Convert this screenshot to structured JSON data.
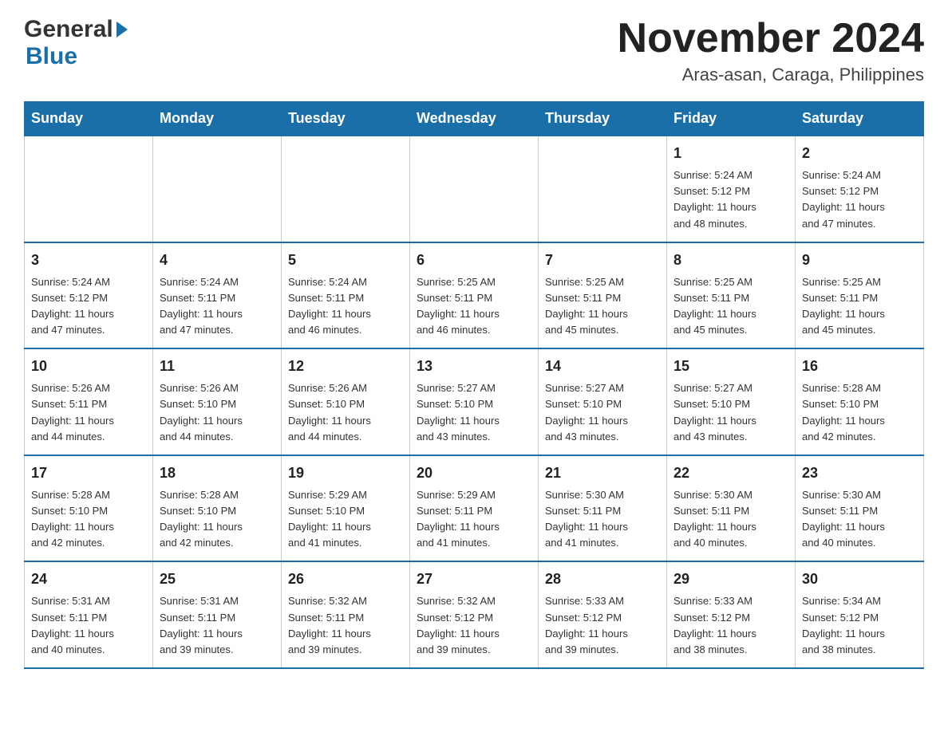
{
  "logo": {
    "general": "General",
    "blue": "Blue"
  },
  "title": {
    "month_year": "November 2024",
    "location": "Aras-asan, Caraga, Philippines"
  },
  "weekdays": [
    "Sunday",
    "Monday",
    "Tuesday",
    "Wednesday",
    "Thursday",
    "Friday",
    "Saturday"
  ],
  "weeks": [
    [
      {
        "day": "",
        "info": ""
      },
      {
        "day": "",
        "info": ""
      },
      {
        "day": "",
        "info": ""
      },
      {
        "day": "",
        "info": ""
      },
      {
        "day": "",
        "info": ""
      },
      {
        "day": "1",
        "info": "Sunrise: 5:24 AM\nSunset: 5:12 PM\nDaylight: 11 hours\nand 48 minutes."
      },
      {
        "day": "2",
        "info": "Sunrise: 5:24 AM\nSunset: 5:12 PM\nDaylight: 11 hours\nand 47 minutes."
      }
    ],
    [
      {
        "day": "3",
        "info": "Sunrise: 5:24 AM\nSunset: 5:12 PM\nDaylight: 11 hours\nand 47 minutes."
      },
      {
        "day": "4",
        "info": "Sunrise: 5:24 AM\nSunset: 5:11 PM\nDaylight: 11 hours\nand 47 minutes."
      },
      {
        "day": "5",
        "info": "Sunrise: 5:24 AM\nSunset: 5:11 PM\nDaylight: 11 hours\nand 46 minutes."
      },
      {
        "day": "6",
        "info": "Sunrise: 5:25 AM\nSunset: 5:11 PM\nDaylight: 11 hours\nand 46 minutes."
      },
      {
        "day": "7",
        "info": "Sunrise: 5:25 AM\nSunset: 5:11 PM\nDaylight: 11 hours\nand 45 minutes."
      },
      {
        "day": "8",
        "info": "Sunrise: 5:25 AM\nSunset: 5:11 PM\nDaylight: 11 hours\nand 45 minutes."
      },
      {
        "day": "9",
        "info": "Sunrise: 5:25 AM\nSunset: 5:11 PM\nDaylight: 11 hours\nand 45 minutes."
      }
    ],
    [
      {
        "day": "10",
        "info": "Sunrise: 5:26 AM\nSunset: 5:11 PM\nDaylight: 11 hours\nand 44 minutes."
      },
      {
        "day": "11",
        "info": "Sunrise: 5:26 AM\nSunset: 5:10 PM\nDaylight: 11 hours\nand 44 minutes."
      },
      {
        "day": "12",
        "info": "Sunrise: 5:26 AM\nSunset: 5:10 PM\nDaylight: 11 hours\nand 44 minutes."
      },
      {
        "day": "13",
        "info": "Sunrise: 5:27 AM\nSunset: 5:10 PM\nDaylight: 11 hours\nand 43 minutes."
      },
      {
        "day": "14",
        "info": "Sunrise: 5:27 AM\nSunset: 5:10 PM\nDaylight: 11 hours\nand 43 minutes."
      },
      {
        "day": "15",
        "info": "Sunrise: 5:27 AM\nSunset: 5:10 PM\nDaylight: 11 hours\nand 43 minutes."
      },
      {
        "day": "16",
        "info": "Sunrise: 5:28 AM\nSunset: 5:10 PM\nDaylight: 11 hours\nand 42 minutes."
      }
    ],
    [
      {
        "day": "17",
        "info": "Sunrise: 5:28 AM\nSunset: 5:10 PM\nDaylight: 11 hours\nand 42 minutes."
      },
      {
        "day": "18",
        "info": "Sunrise: 5:28 AM\nSunset: 5:10 PM\nDaylight: 11 hours\nand 42 minutes."
      },
      {
        "day": "19",
        "info": "Sunrise: 5:29 AM\nSunset: 5:10 PM\nDaylight: 11 hours\nand 41 minutes."
      },
      {
        "day": "20",
        "info": "Sunrise: 5:29 AM\nSunset: 5:11 PM\nDaylight: 11 hours\nand 41 minutes."
      },
      {
        "day": "21",
        "info": "Sunrise: 5:30 AM\nSunset: 5:11 PM\nDaylight: 11 hours\nand 41 minutes."
      },
      {
        "day": "22",
        "info": "Sunrise: 5:30 AM\nSunset: 5:11 PM\nDaylight: 11 hours\nand 40 minutes."
      },
      {
        "day": "23",
        "info": "Sunrise: 5:30 AM\nSunset: 5:11 PM\nDaylight: 11 hours\nand 40 minutes."
      }
    ],
    [
      {
        "day": "24",
        "info": "Sunrise: 5:31 AM\nSunset: 5:11 PM\nDaylight: 11 hours\nand 40 minutes."
      },
      {
        "day": "25",
        "info": "Sunrise: 5:31 AM\nSunset: 5:11 PM\nDaylight: 11 hours\nand 39 minutes."
      },
      {
        "day": "26",
        "info": "Sunrise: 5:32 AM\nSunset: 5:11 PM\nDaylight: 11 hours\nand 39 minutes."
      },
      {
        "day": "27",
        "info": "Sunrise: 5:32 AM\nSunset: 5:12 PM\nDaylight: 11 hours\nand 39 minutes."
      },
      {
        "day": "28",
        "info": "Sunrise: 5:33 AM\nSunset: 5:12 PM\nDaylight: 11 hours\nand 39 minutes."
      },
      {
        "day": "29",
        "info": "Sunrise: 5:33 AM\nSunset: 5:12 PM\nDaylight: 11 hours\nand 38 minutes."
      },
      {
        "day": "30",
        "info": "Sunrise: 5:34 AM\nSunset: 5:12 PM\nDaylight: 11 hours\nand 38 minutes."
      }
    ]
  ]
}
